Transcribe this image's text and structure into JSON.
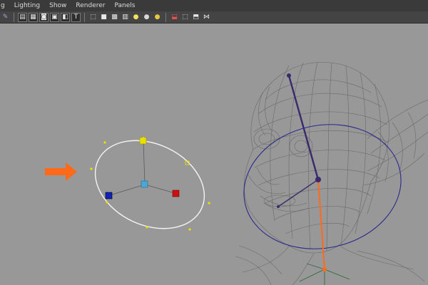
{
  "menubar": {
    "items": [
      {
        "label": "g"
      },
      {
        "label": "Lighting"
      },
      {
        "label": "Show"
      },
      {
        "label": "Renderer"
      },
      {
        "label": "Panels"
      }
    ]
  },
  "toolbar": {
    "groups": [
      [
        {
          "icon": "camera-icon",
          "glyph": "✎"
        }
      ],
      [
        {
          "icon": "grid-icon",
          "glyph": "▤"
        },
        {
          "icon": "film-icon",
          "glyph": "▦"
        },
        {
          "icon": "resolution-gate-icon",
          "glyph": "◙"
        },
        {
          "icon": "safe-frame-icon",
          "glyph": "▣"
        },
        {
          "icon": "field-chart-icon",
          "glyph": "◧"
        },
        {
          "icon": "text-icon",
          "glyph": "T"
        }
      ],
      [
        {
          "icon": "wireframe-cube-icon",
          "glyph": "⬚"
        },
        {
          "icon": "smooth-shade-icon",
          "glyph": "■"
        },
        {
          "icon": "wireframe-on-shaded-icon",
          "glyph": "▩"
        },
        {
          "icon": "texture-icon",
          "glyph": "▥"
        },
        {
          "icon": "default-light-icon",
          "glyph": "●"
        },
        {
          "icon": "all-lights-icon",
          "glyph": "●"
        },
        {
          "icon": "shadow-icon",
          "glyph": "●"
        }
      ],
      [
        {
          "icon": "isolate-select-icon",
          "glyph": "⬓"
        },
        {
          "icon": "xray-icon",
          "glyph": "⬚"
        },
        {
          "icon": "xray-joints-icon",
          "glyph": "⬒"
        },
        {
          "icon": "share-icon",
          "glyph": "⋈"
        }
      ]
    ]
  },
  "colors": {
    "viewport_bg": "#989898",
    "menubar_bg": "#3a3a3a",
    "toolbar_bg": "#444444",
    "callout_arrow": "#ff6a1a",
    "selection_circle": "#ffffff",
    "handle_yellow": "#e8e000",
    "handle_red": "#cc1111",
    "handle_blue": "#1122bb",
    "handle_cyan": "#4aa8d8",
    "wireframe": "#6a6a6a",
    "bone": "#3b2a6b",
    "influence_circle": "#2a2a8a",
    "joint_highlight": "#ff6a1a"
  },
  "viewport": {
    "callout": "arrow pointing right",
    "manipulator": "circle with move handles",
    "model": "wireframe head with elf ear and joint chain"
  }
}
